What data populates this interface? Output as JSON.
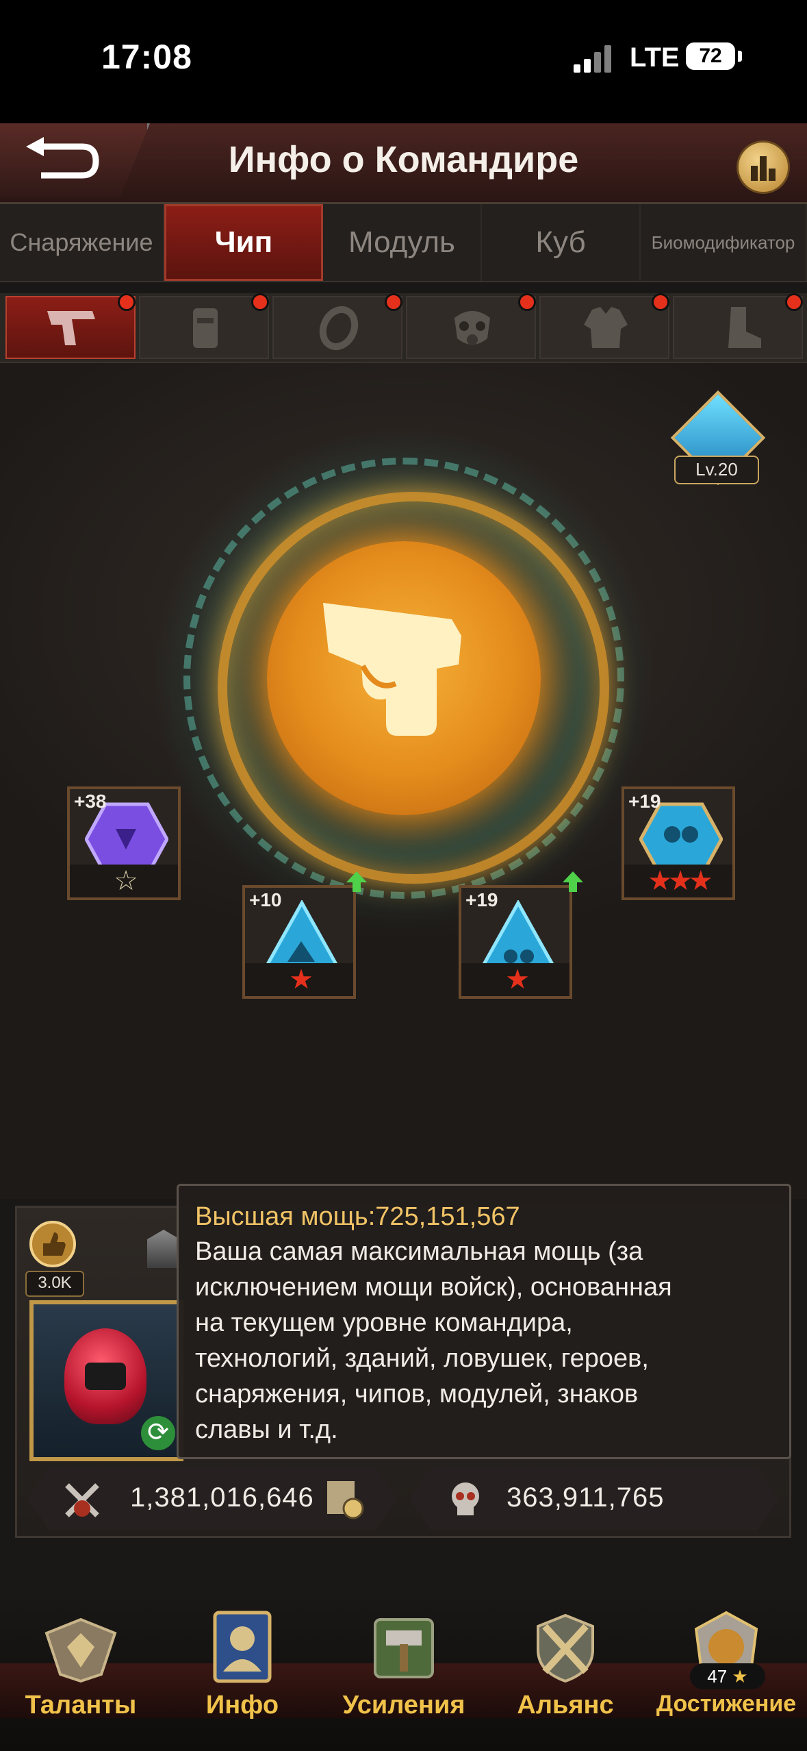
{
  "status_bar": {
    "time": "17:08",
    "network": "LTE",
    "battery": "72"
  },
  "header": {
    "title": "Инфо о Командире"
  },
  "tabs": [
    {
      "label": "Снаряжение"
    },
    {
      "label": "Чип"
    },
    {
      "label": "Модуль"
    },
    {
      "label": "Куб"
    },
    {
      "label": "Биомодификатор"
    }
  ],
  "subtabs": [
    {
      "icon": "pistol-icon"
    },
    {
      "icon": "vest-icon"
    },
    {
      "icon": "ring-icon"
    },
    {
      "icon": "gas-mask-icon"
    },
    {
      "icon": "armor-icon"
    },
    {
      "icon": "boot-icon"
    }
  ],
  "main": {
    "level_badge": "Lv.20",
    "chips": [
      {
        "level": "+38",
        "stars": 1,
        "color": "#7a4ee0"
      },
      {
        "level": "+10",
        "stars": 1,
        "color": "#2aa7d8"
      },
      {
        "level": "+19",
        "stars": 1,
        "color": "#2aa7d8"
      },
      {
        "level": "+19",
        "stars": 3,
        "color": "#2aa7d8"
      }
    ]
  },
  "commander": {
    "likes": "3.0K",
    "tooltip_title": "Высшая мощь:725,151,567",
    "tooltip_lines": [
      "Ваша самая максимальная мощь (за",
      "исключением мощи войск), основанная",
      "на текущем уровне командира,",
      "технологий, зданий, ловушек, героев,",
      "снаряжения, чипов, модулей, знаков",
      "славы и т.д."
    ],
    "power": "1,381,016,646",
    "kills": "363,911,765"
  },
  "bottom_nav": [
    {
      "label": "Таланты"
    },
    {
      "label": "Инфо"
    },
    {
      "label": "Усиления"
    },
    {
      "label": "Альянс"
    },
    {
      "label": "Достижение",
      "count": "47"
    }
  ],
  "colors": {
    "accent_red": "#8c1e16",
    "gold": "#f0c24a",
    "star_red": "#e5311c"
  }
}
